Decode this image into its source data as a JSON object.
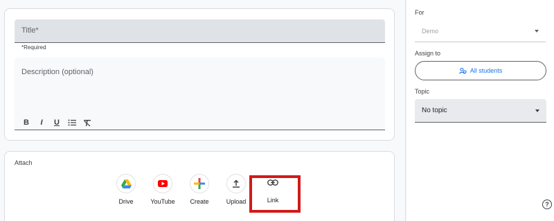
{
  "editor": {
    "title_placeholder": "Title*",
    "required_note": "*Required",
    "description_placeholder": "Description (optional)",
    "format_buttons": [
      "B",
      "I",
      "U"
    ]
  },
  "attach": {
    "label": "Attach",
    "items": [
      {
        "label": "Drive",
        "icon": "drive-icon"
      },
      {
        "label": "YouTube",
        "icon": "youtube-icon"
      },
      {
        "label": "Create",
        "icon": "plus-icon"
      },
      {
        "label": "Upload",
        "icon": "upload-icon"
      },
      {
        "label": "Link",
        "icon": "link-icon"
      }
    ],
    "highlight_color": "#d01a1a"
  },
  "sidebar": {
    "for_label": "For",
    "for_value": "Demo",
    "assign_label": "Assign to",
    "assign_button": "All students",
    "topic_label": "Topic",
    "topic_value": "No topic"
  },
  "colors": {
    "accent": "#1a73e8"
  }
}
